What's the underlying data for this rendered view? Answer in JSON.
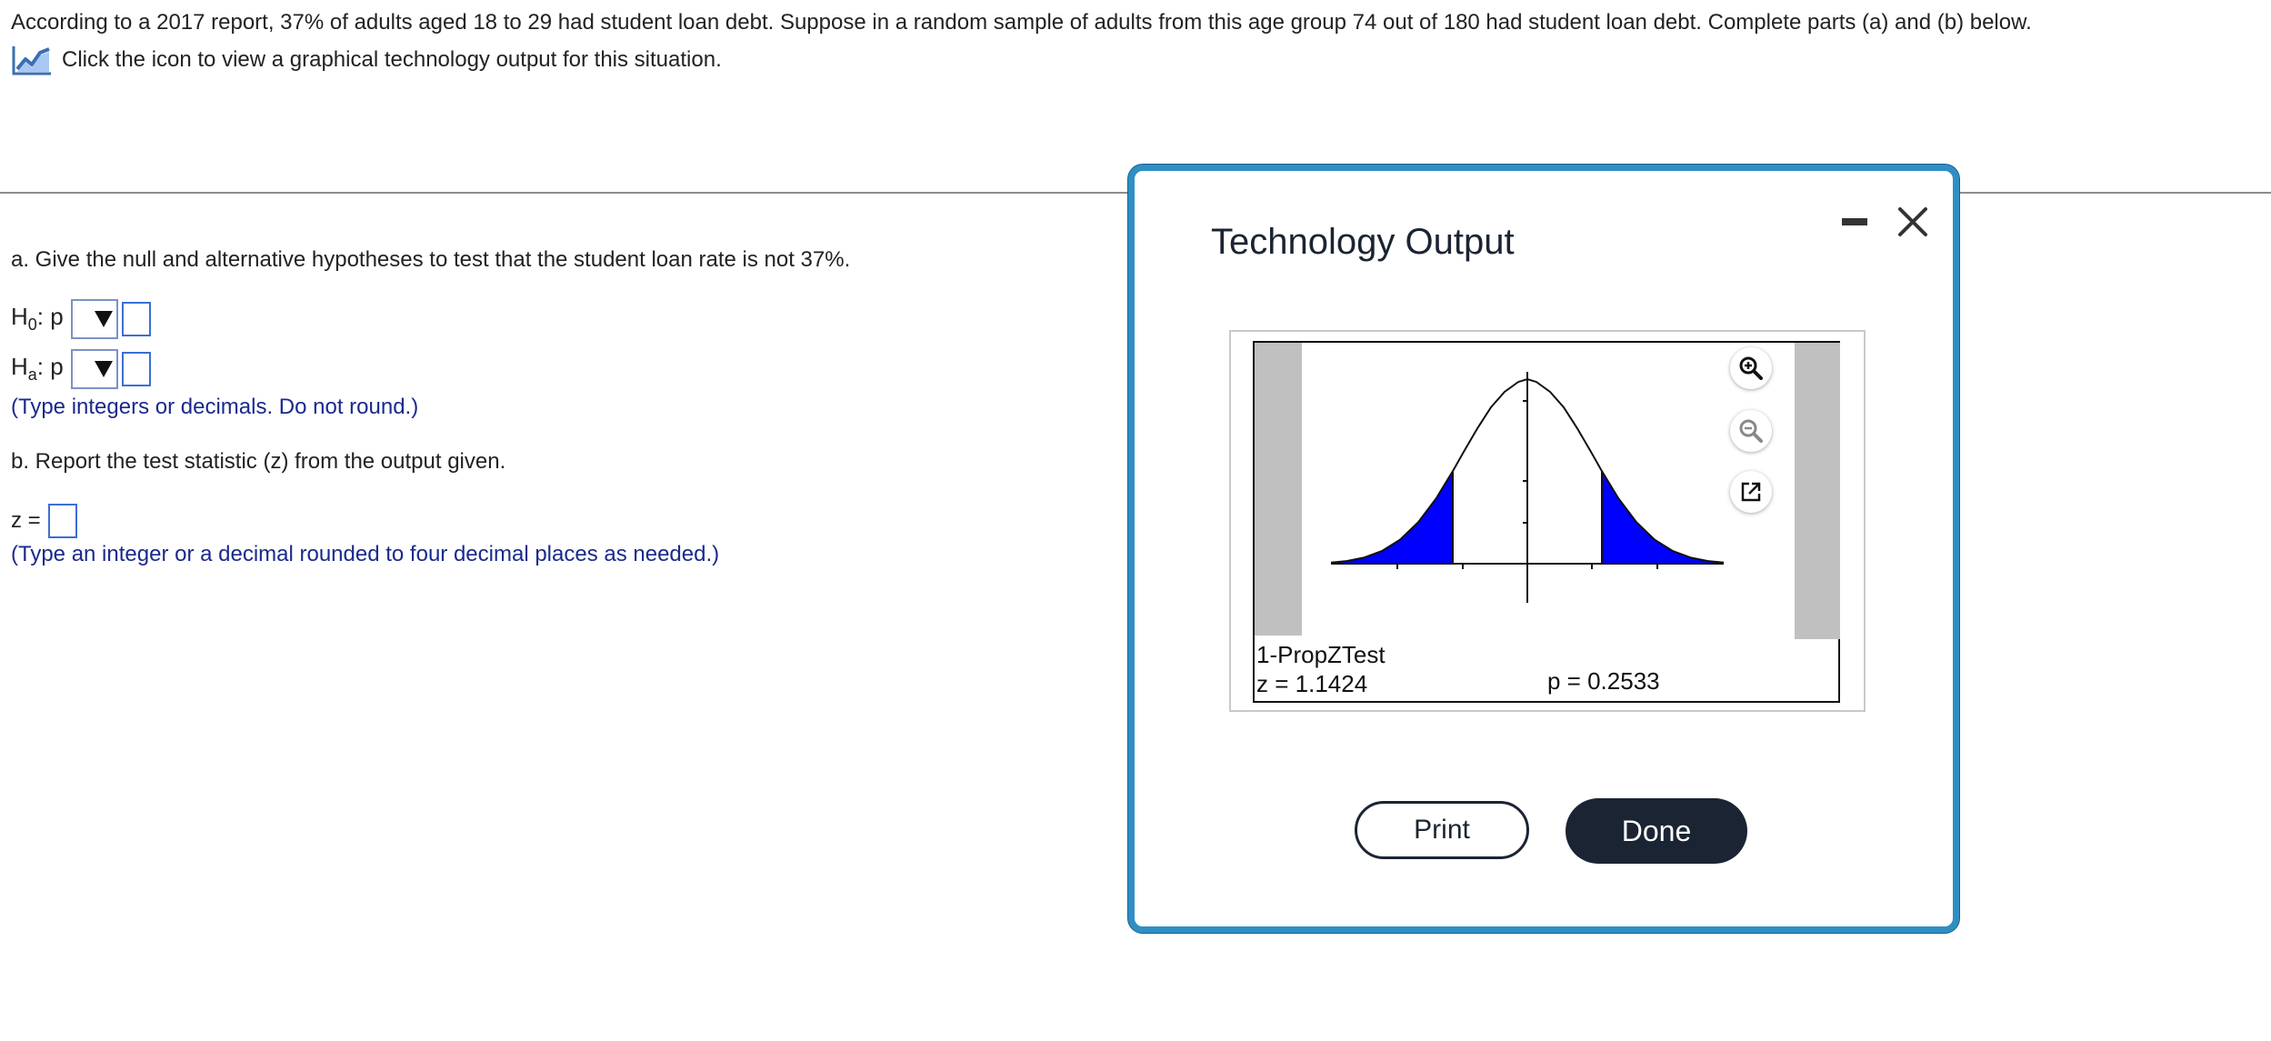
{
  "question": {
    "text": "According to a 2017 report, 37% of adults aged 18 to 29 had student loan debt. Suppose in a random sample of adults from this age group 74 out of 180 had student loan debt. Complete parts (a) and (b) below.",
    "tech_link": "Click the icon to view a graphical technology output for this situation."
  },
  "part_a": {
    "prompt": "a. Give the null and alternative hypotheses to test that the student loan rate is not 37%.",
    "h0": {
      "letter": "H",
      "sub": "0",
      "param": ": p"
    },
    "ha": {
      "letter": "H",
      "sub": "a",
      "param": ": p"
    },
    "hint": "(Type integers or decimals. Do not round.)"
  },
  "part_b": {
    "prompt": "b. Report the test statistic (z) from the output given.",
    "z_label": "z =",
    "hint": "(Type an integer or a decimal rounded to four decimal places as needed.)"
  },
  "modal": {
    "title": "Technology Output",
    "test_name": "1-PropZTest",
    "z_value": "z = 1.1424",
    "p_value": "p = 0.2533",
    "print_label": "Print",
    "done_label": "Done"
  },
  "icons": [
    "chart-icon",
    "minimize-icon",
    "close-icon",
    "zoom-in-icon",
    "zoom-out-icon",
    "popout-icon",
    "dropdown-arrow-icon"
  ],
  "colors": {
    "accent_border": "#2f8fc4",
    "shaded_tail": "#0000ff",
    "button_dark": "#1b2433",
    "hint_text": "#1a2a8c",
    "input_border": "#3b6fd4"
  }
}
